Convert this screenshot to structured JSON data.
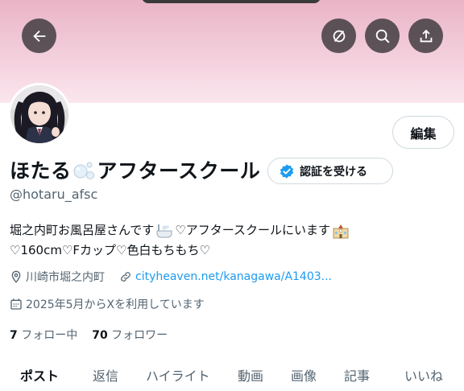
{
  "header": {
    "back_icon": "arrow-left-icon",
    "actions": [
      "hide-icon",
      "search-icon",
      "share-icon"
    ]
  },
  "profile": {
    "display_name_part1": "ほたる",
    "display_name_part2": "アフタースクール",
    "handle": "@hotaru_afsc",
    "edit_label": "編集",
    "verify_label": "認証を受ける",
    "bio_line1_a": "堀之内町お風呂屋さんです",
    "bio_line1_b": "♡アフタースクールにいます",
    "bio_line2": "♡160cm♡Fカップ♡色白もちもち♡",
    "location": "川崎市堀之内町",
    "website": "cityheaven.net/kanagawa/A1403...",
    "joined": "2025年5月からXを利用しています",
    "following_count": "7",
    "following_label": "フォロー中",
    "followers_count": "70",
    "followers_label": "フォロワー"
  },
  "tabs": [
    "ポスト",
    "返信",
    "ハイライト",
    "動画",
    "画像",
    "記事",
    "いいね"
  ],
  "colors": {
    "accent": "#1d9bf0",
    "banner": "#f3cfdc",
    "text": "#0f1419",
    "muted": "#536471"
  }
}
